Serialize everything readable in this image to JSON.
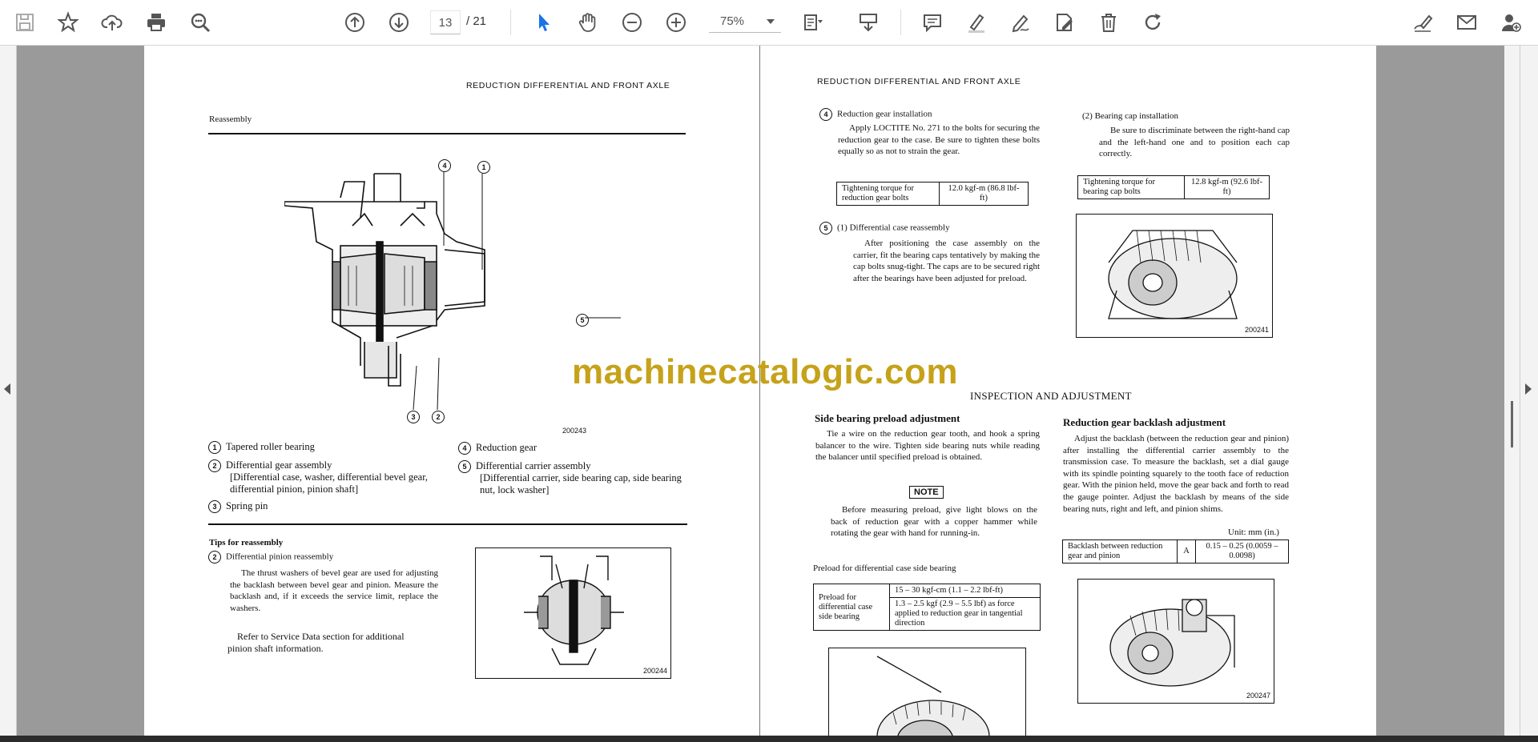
{
  "toolbar": {
    "page_current": "13",
    "page_total": "/ 21",
    "zoom": "75%",
    "icons": [
      "save-icon",
      "star-icon",
      "cloud-upload-icon",
      "print-icon",
      "zoom-search-icon",
      "page-up-icon",
      "page-down-icon",
      "select-cursor-icon",
      "hand-icon",
      "zoom-out-icon",
      "zoom-in-icon",
      "fit-page-icon",
      "scroll-mode-icon",
      "comment-icon",
      "highlight-icon",
      "draw-icon",
      "edit-icon",
      "trash-icon",
      "rotate-icon",
      "sign-icon",
      "mail-icon",
      "account-icon"
    ],
    "accent": "#1a73e8"
  },
  "watermark": "machinecatalogic.com",
  "left_page": {
    "header": "REDUCTION DIFFERENTIAL AND FRONT AXLE",
    "section": "Reassembly",
    "callouts": [
      "4",
      "1",
      "5",
      "3",
      "2"
    ],
    "figure_top_no": "200243",
    "legend": [
      {
        "num": "1",
        "label": "Tapered roller bearing"
      },
      {
        "num": "2",
        "label": "Differential gear assembly",
        "detail": "[Differential case, washer, differential bevel gear, differential pinion, pinion shaft]"
      },
      {
        "num": "3",
        "label": "Spring pin"
      },
      {
        "num": "4",
        "label": "Reduction gear"
      },
      {
        "num": "5",
        "label": "Differential carrier assembly",
        "detail": "[Differential carrier, side bearing cap, side bearing nut, lock washer]"
      }
    ],
    "tips_title": "Tips for reassembly",
    "tip_num": "2",
    "tip_heading": "Differential pinion reassembly",
    "tip_body": "The thrust washers of bevel gear are used for adjusting the backlash between bevel gear and pinion. Measure the backlash and, if it exceeds the service limit, replace the washers.",
    "tip_ref": "Refer to Service Data section for additional pinion shaft information.",
    "figure_bottom_no": "200244"
  },
  "right_page": {
    "header": "REDUCTION DIFFERENTIAL AND FRONT AXLE",
    "item4_num": "4",
    "item4_title": "Reduction gear installation",
    "item4_body": "Apply LOCTITE No. 271 to the bolts for securing the reduction gear to the case. Be sure to tighten these bolts equally so as not to strain the gear.",
    "torque1_label": "Tightening torque for reduction gear bolts",
    "torque1_value": "12.0 kgf-m (86.8 lbf-ft)",
    "item5_num": "5",
    "item5_title": "(1)  Differential case reassembly",
    "item5_body": "After positioning the case assembly on the carrier, fit the bearing caps tentatively by making the cap bolts snug-tight. The caps are to be secured right after the bearings have been adjusted for preload.",
    "bearing_cap_title": "(2)  Bearing cap installation",
    "bearing_cap_body": "Be sure to discriminate between the right-hand cap and the left-hand one and to position each cap correctly.",
    "torque2_label": "Tightening torque for bearing cap bolts",
    "torque2_value": "12.8 kgf-m (92.6 lbf-ft)",
    "figure_241": "200241",
    "section_title": "INSPECTION AND ADJUSTMENT",
    "side_title": "Side bearing preload adjustment",
    "side_body": "Tie a wire on the reduction gear tooth, and hook a spring balancer to the wire. Tighten side bearing nuts while reading the balancer until specified preload is obtained.",
    "note_label": "NOTE",
    "note_body": "Before measuring preload, give light blows on the back of reduction gear with a copper hammer while rotating the gear with hand for running-in.",
    "preload_caption": "Preload for differential case side bearing",
    "preload_label": "Preload for differential case side bearing",
    "preload_v1": "15 – 30 kgf-cm (1.1 – 2.2 lbf-ft)",
    "preload_v2": "1.3 – 2.5 kgf (2.9 – 5.5 lbf) as force applied to reduction gear in tangential direction",
    "backlash_title": "Reduction gear backlash adjustment",
    "backlash_body": "Adjust the backlash (between the reduction gear and pinion) after installing the differential carrier assembly to the transmission case. To measure the backlash, set a dial gauge with its spindle pointing squarely to the tooth face of reduction gear. With the pinion held, move the gear back and forth to read the gauge pointer. Adjust the backlash by means of the side bearing nuts, right and left, and pinion shims.",
    "unit": "Unit: mm (in.)",
    "backlash_label": "Backlash between reduction gear and pinion",
    "backlash_code": "A",
    "backlash_value": "0.15 – 0.25 (0.0059 – 0.0098)",
    "figure_247": "200247"
  }
}
